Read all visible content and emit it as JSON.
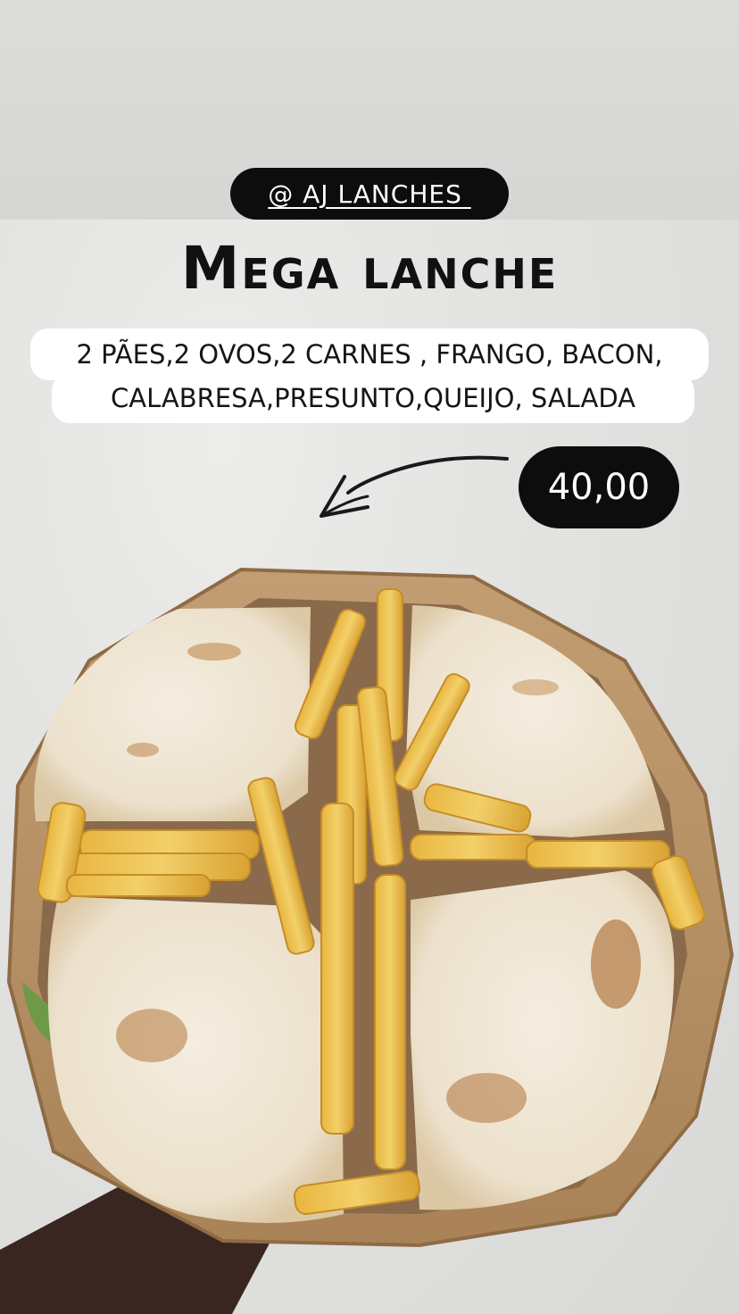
{
  "header": {
    "handle": "@ AJ LANCHES ",
    "title": "Mega lanche",
    "description_line1": "2 PÃES,2 OVOS,2 CARNES , FRANGO, BACON,",
    "description_line2": "CALABRESA,PRESUNTO,QUEIJO, SALADA",
    "price": "40,00"
  },
  "colors": {
    "pill_background": "#0d0d0d",
    "box_cardboard": "#b99468",
    "bread": "#efe6d6",
    "fries": "#e9bd45"
  },
  "icons": {
    "arrow": "hand-drawn-arrow-icon"
  }
}
